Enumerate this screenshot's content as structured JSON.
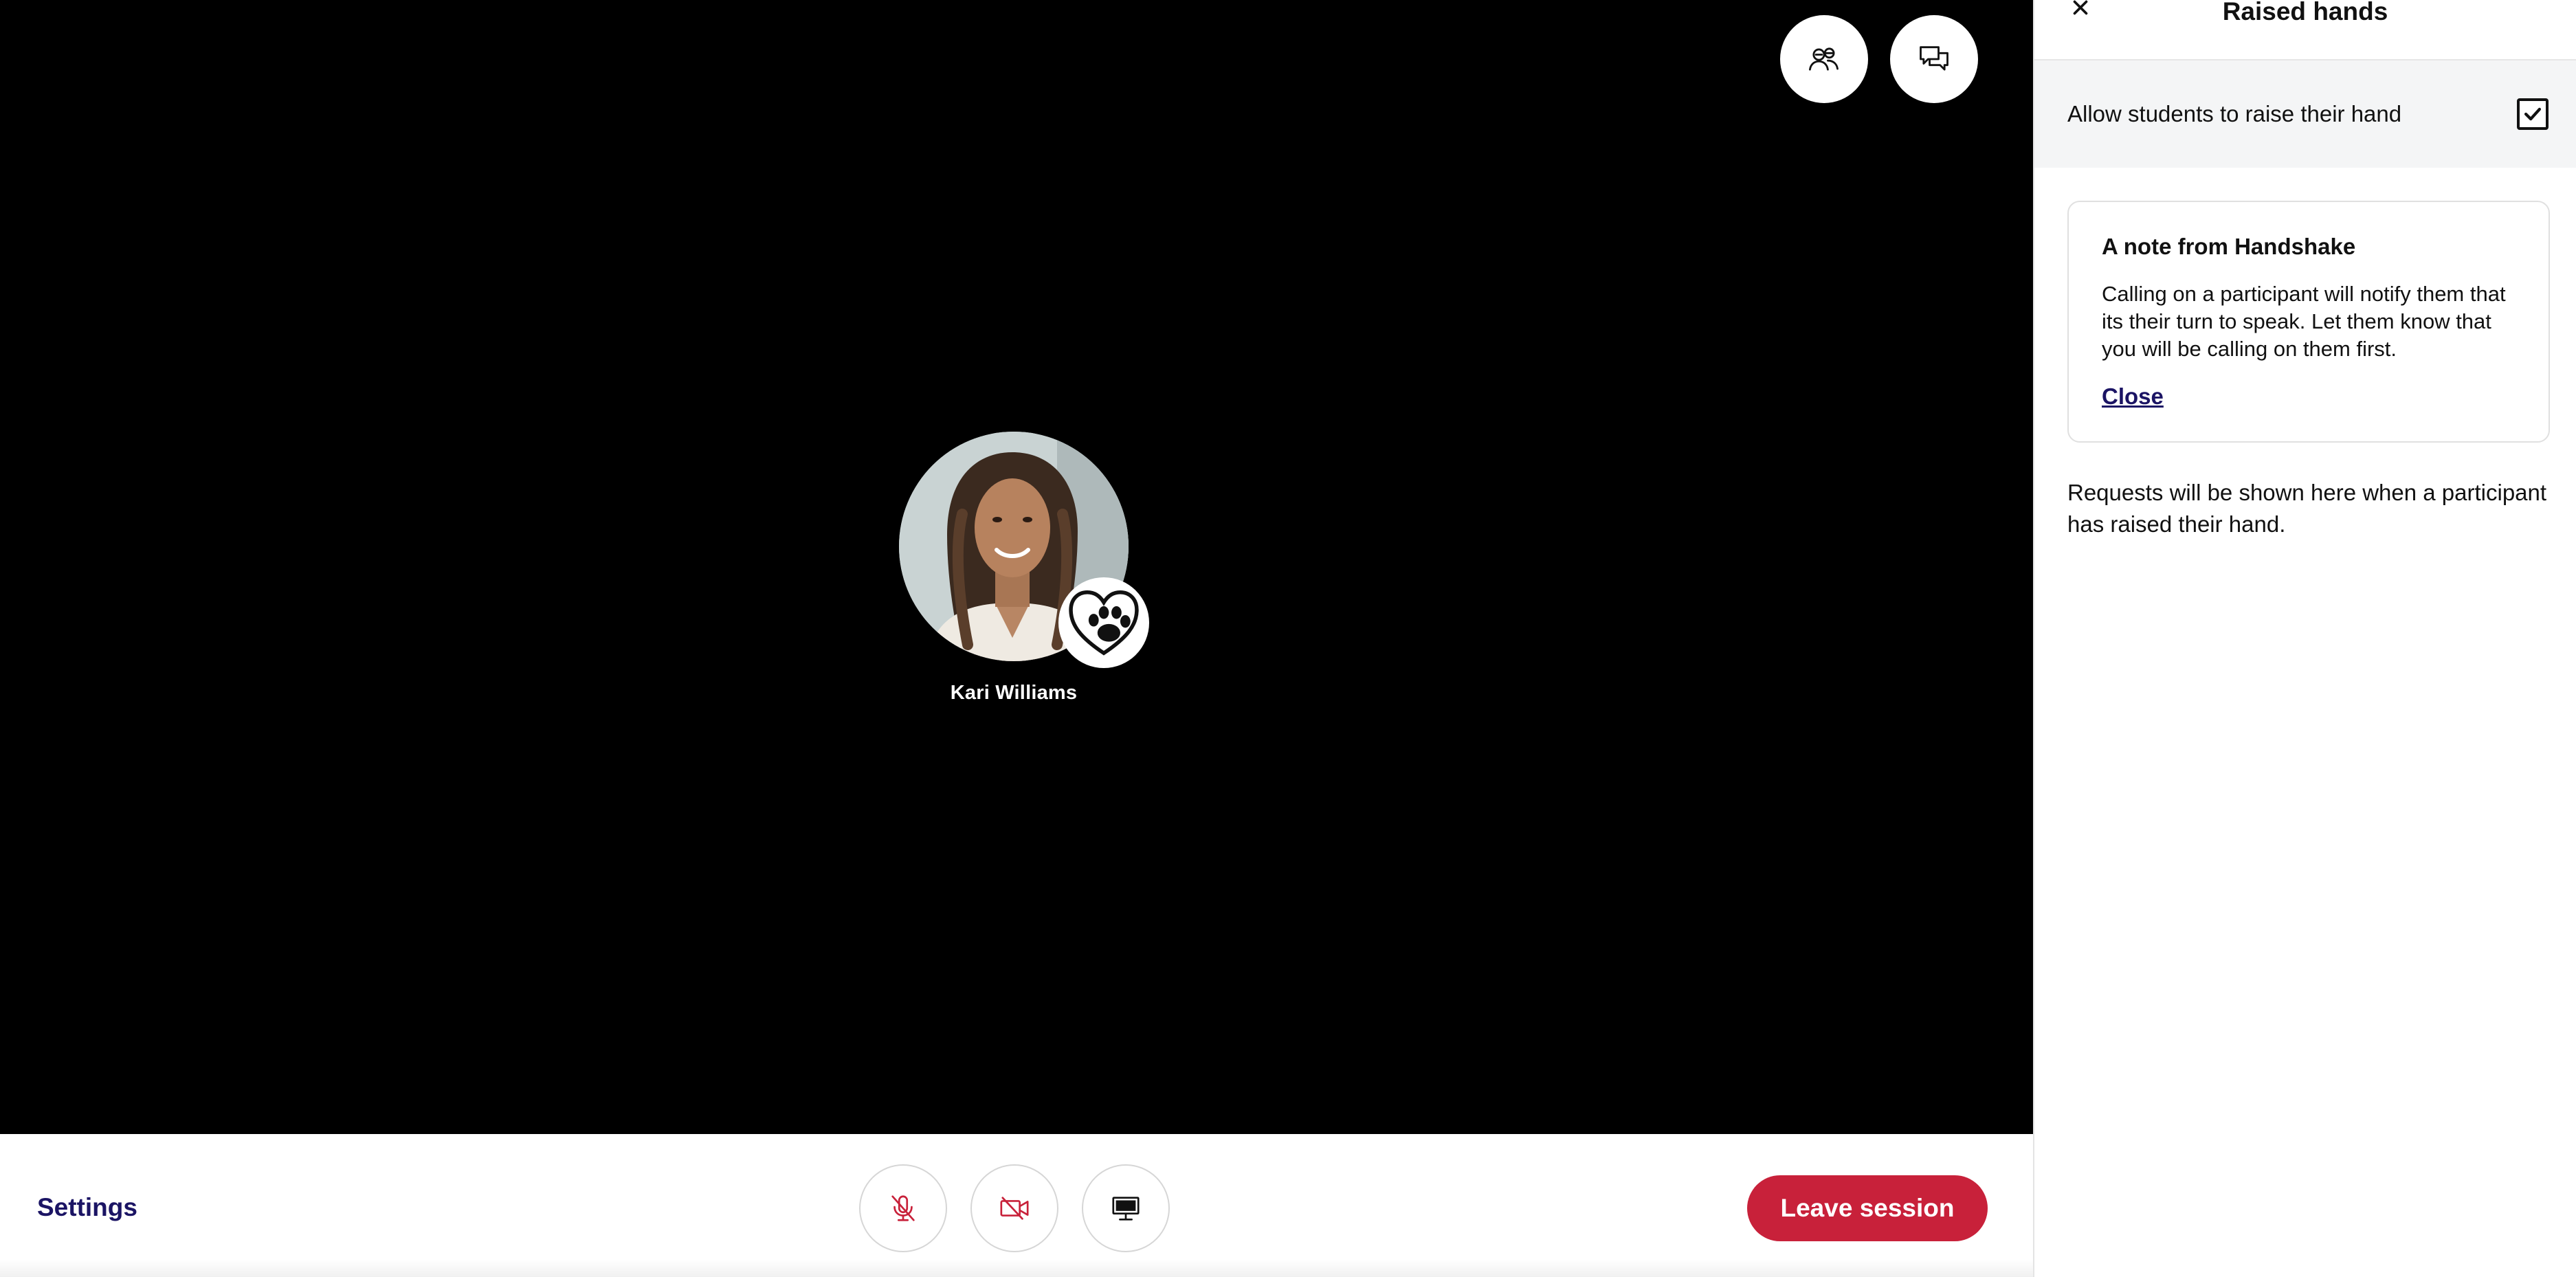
{
  "stage": {
    "participant_name": "Kari Williams",
    "top_actions": [
      {
        "name": "participants-icon"
      },
      {
        "name": "chat-icon"
      }
    ]
  },
  "toolbar": {
    "settings_label": "Settings",
    "controls": [
      {
        "name": "mic-muted-icon",
        "state": "off",
        "color": "#c8213a"
      },
      {
        "name": "camera-off-icon",
        "state": "off",
        "color": "#c8213a"
      },
      {
        "name": "screen-share-icon",
        "state": "available",
        "color": "#111111"
      }
    ],
    "leave_label": "Leave session"
  },
  "panel": {
    "title": "Raised hands",
    "allow_label": "Allow students to raise their hand",
    "allow_checked": true,
    "note": {
      "title": "A note from Handshake",
      "body": "Calling on a participant will notify them that its their turn to speak. Let them know that you will be calling on them first.",
      "close_label": "Close"
    },
    "requests_text": "Requests will be shown here when a participant has raised their hand."
  },
  "colors": {
    "brand_navy": "#1b1464",
    "danger_red": "#c8213a",
    "stage_bg": "#000000",
    "panel_row_bg": "#f4f5f6"
  }
}
